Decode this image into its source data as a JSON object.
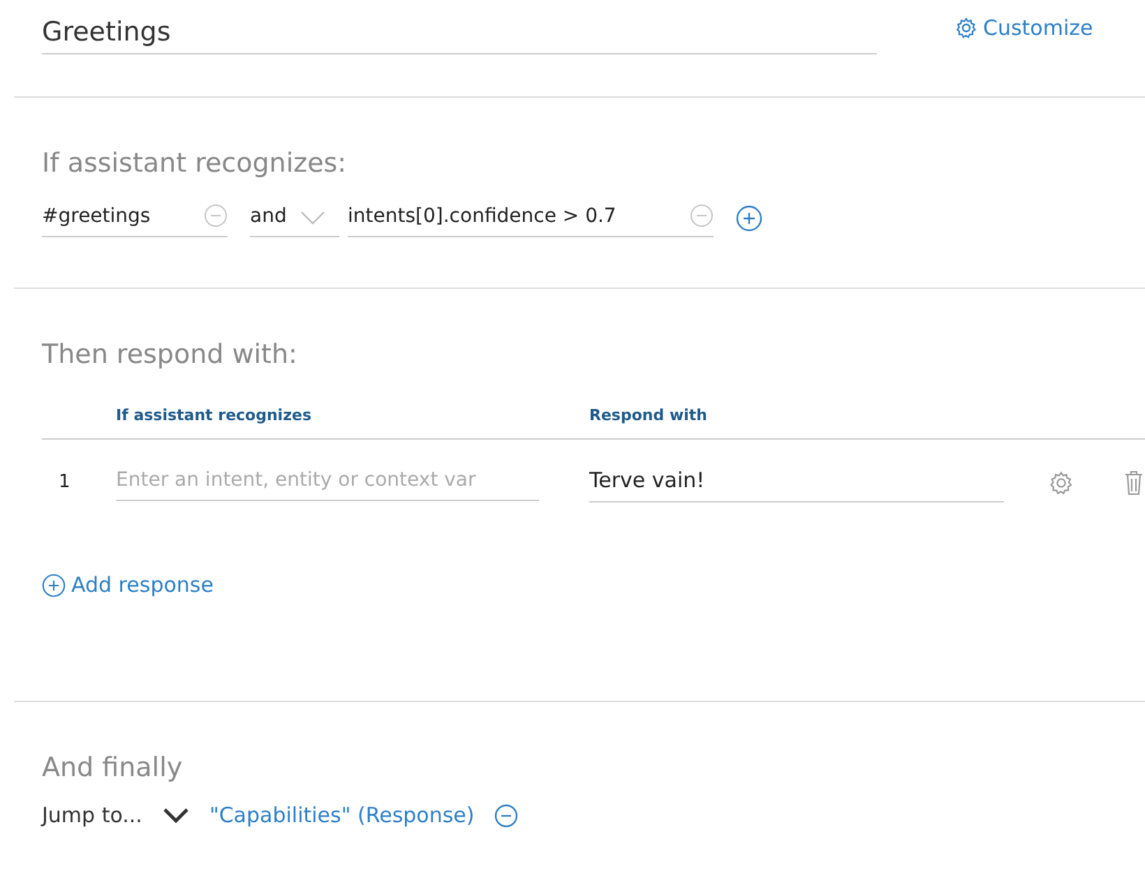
{
  "node": {
    "title": "Greetings",
    "customize": "Customize"
  },
  "condition_section": {
    "heading": "If assistant recognizes:",
    "conditions": [
      {
        "kind": "field",
        "value": "#greetings"
      },
      {
        "kind": "select",
        "value": "and"
      },
      {
        "kind": "field",
        "value": "intents[0].confidence > 0.7"
      }
    ]
  },
  "response_section": {
    "heading": "Then respond with:",
    "columns": [
      "If assistant recognizes",
      "Respond with"
    ],
    "rows": [
      {
        "number": "1",
        "condition_placeholder": "Enter an intent, entity or context var",
        "response": "Terve vain!"
      }
    ],
    "add_response": "Add response"
  },
  "finally_section": {
    "heading": "And finally",
    "action": "Jump to...",
    "target": "\"Capabilities\" (Response)"
  }
}
